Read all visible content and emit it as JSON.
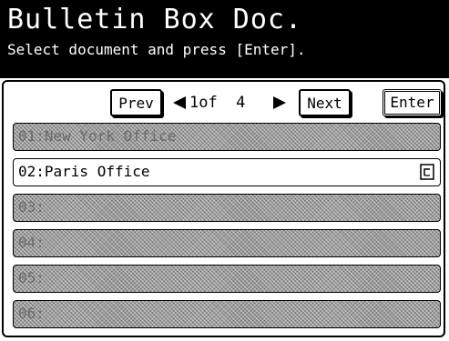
{
  "header": {
    "title": "Bulletin Box Doc.",
    "subtitle": "Select document and press [Enter]."
  },
  "nav": {
    "prev_label": "Prev",
    "next_label": "Next",
    "enter_label": "Enter",
    "page_info": "1of  4"
  },
  "documents": [
    {
      "label": "01:New York Office",
      "state": "disabled"
    },
    {
      "label": "02:Paris Office",
      "state": "selectable",
      "icon": "document-icon"
    },
    {
      "label": "03:",
      "state": "disabled"
    },
    {
      "label": "04:",
      "state": "disabled"
    },
    {
      "label": "05:",
      "state": "disabled"
    },
    {
      "label": "06:",
      "state": "disabled"
    }
  ]
}
